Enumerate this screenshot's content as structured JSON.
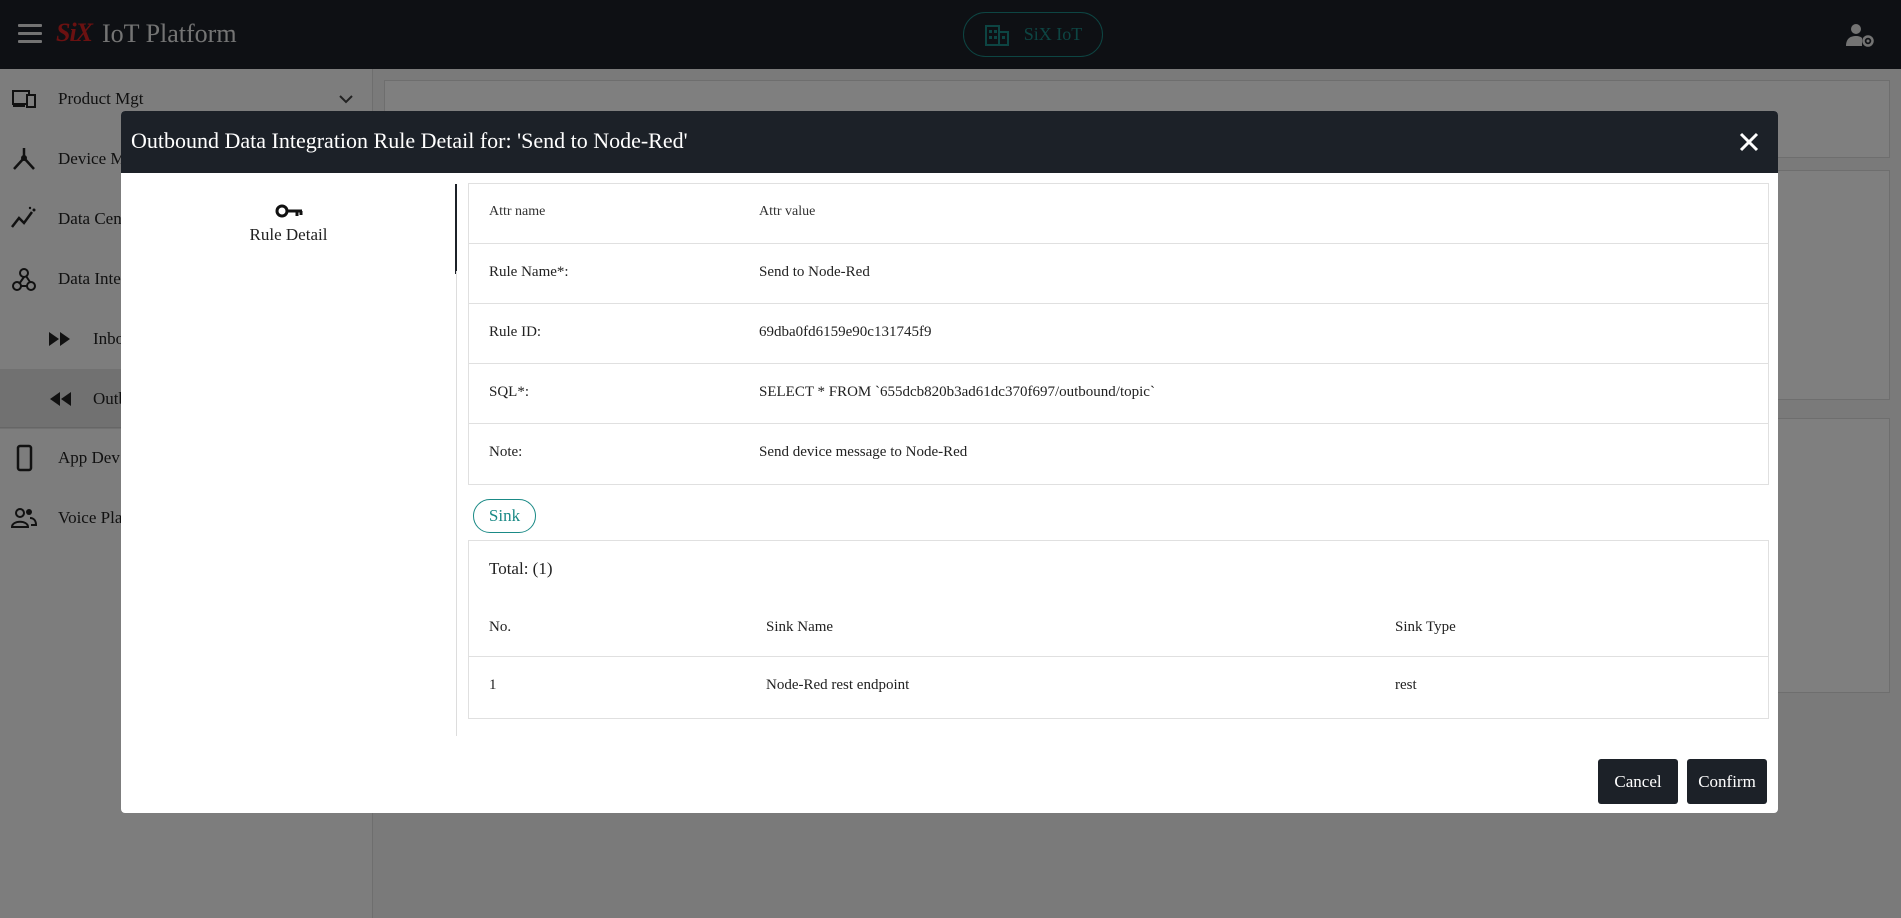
{
  "topbar": {
    "logo_text": "SiX",
    "title": "IoT Platform",
    "workspace_label": "SiX IoT"
  },
  "sidebar": {
    "items": [
      {
        "label": "Product Mgt",
        "icon": "devices-icon"
      },
      {
        "label": "Device Mgt",
        "icon": "hub-icon"
      },
      {
        "label": "Data Center",
        "icon": "chart-line-icon"
      },
      {
        "label": "Data Integration",
        "icon": "webhook-icon"
      },
      {
        "label": "Inbound",
        "icon": "fast-forward-icon"
      },
      {
        "label": "Outbound",
        "icon": "rewind-icon"
      },
      {
        "label": "App Dev",
        "icon": "phone-icon"
      },
      {
        "label": "Voice Platform",
        "icon": "people-icon"
      }
    ]
  },
  "modal": {
    "title": "Outbound Data Integration Rule Detail for: 'Send to Node-Red'",
    "tab_label": "Rule Detail",
    "attr_table": {
      "header": {
        "name": "Attr name",
        "value": "Attr value"
      },
      "rows": [
        {
          "name": "Rule Name*:",
          "value": "Send to Node-Red"
        },
        {
          "name": "Rule ID:",
          "value": "69dba0fd6159e90c131745f9"
        },
        {
          "name": "SQL*:",
          "value": "SELECT * FROM `655dcb820b3ad61dc370f697/outbound/topic`"
        },
        {
          "name": "Note:",
          "value": "Send device message to Node-Red"
        }
      ]
    },
    "sink_chip": "Sink",
    "sink_table": {
      "total": "Total: (1)",
      "headers": [
        "No.",
        "Sink Name",
        "Sink Type"
      ],
      "rows": [
        [
          "1",
          "Node-Red rest endpoint",
          "rest"
        ]
      ]
    },
    "cancel_label": "Cancel",
    "confirm_label": "Confirm"
  }
}
